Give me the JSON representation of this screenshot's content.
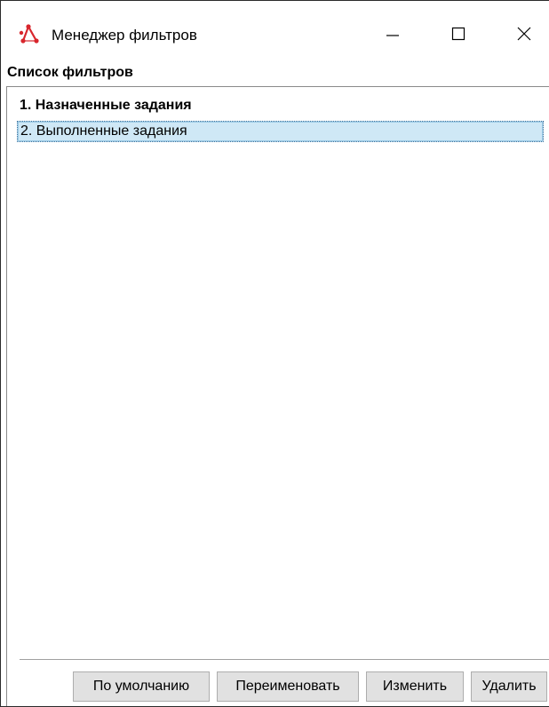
{
  "window": {
    "title": "Менеджер фильтров",
    "app_icon": "graph-network-icon",
    "controls": {
      "minimize_icon": "minimize-icon",
      "maximize_icon": "maximize-icon",
      "close_icon": "close-icon"
    }
  },
  "filters": {
    "section_label": "Список фильтров",
    "items": [
      {
        "label": "1. Назначенные задания",
        "selected": false
      },
      {
        "label": "2. Выполненные задания",
        "selected": true
      }
    ]
  },
  "buttons": {
    "default_label": "По умолчанию",
    "rename_label": "Переименовать",
    "edit_label": "Изменить",
    "delete_label": "Удалить"
  },
  "colors": {
    "accent_icon": "#d8262d",
    "selection_bg": "#cfe8f6"
  }
}
